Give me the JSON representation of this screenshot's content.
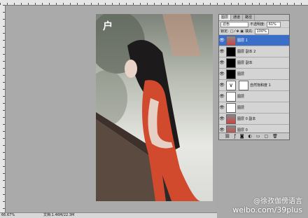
{
  "status_bar": {
    "zoom": "66.67%",
    "doc_info": "文档:1.46M/22.3M"
  },
  "layers_panel": {
    "tabs": [
      "图层",
      "通道",
      "路径"
    ],
    "blend_mode": "滤色",
    "opacity_label": "不透明度:",
    "opacity_value": "61%",
    "lock_label": "锁定:",
    "fill_label": "填充:",
    "fill_value": "100%",
    "layers": [
      {
        "name": "图层 1",
        "selected": true,
        "thumb": "photo"
      },
      {
        "name": "图层 副本 2",
        "selected": false,
        "thumb": "black"
      },
      {
        "name": "图层 副本",
        "selected": false,
        "thumb": "black"
      },
      {
        "name": "图层",
        "selected": false,
        "thumb": "black"
      },
      {
        "name": "自然饱和度 1",
        "selected": false,
        "thumb": "adjust"
      },
      {
        "name": "图层",
        "selected": false,
        "thumb": "white"
      },
      {
        "name": "图层",
        "selected": false,
        "thumb": "white"
      },
      {
        "name": "图层 0 副本",
        "selected": false,
        "thumb": "photo"
      },
      {
        "name": "图层 0",
        "selected": false,
        "thumb": "photo"
      }
    ],
    "footer_icons": [
      "link-icon",
      "fx-icon",
      "mask-icon",
      "adjustment-icon",
      "folder-icon",
      "new-layer-icon",
      "trash-icon"
    ]
  },
  "photo_logo": "户",
  "watermark": {
    "line1": "@徐孜伽傍语言",
    "line2": "weibo.com/39plus"
  },
  "colors": {
    "selection": "#3a6fc9",
    "dress": "#d24a2e"
  }
}
